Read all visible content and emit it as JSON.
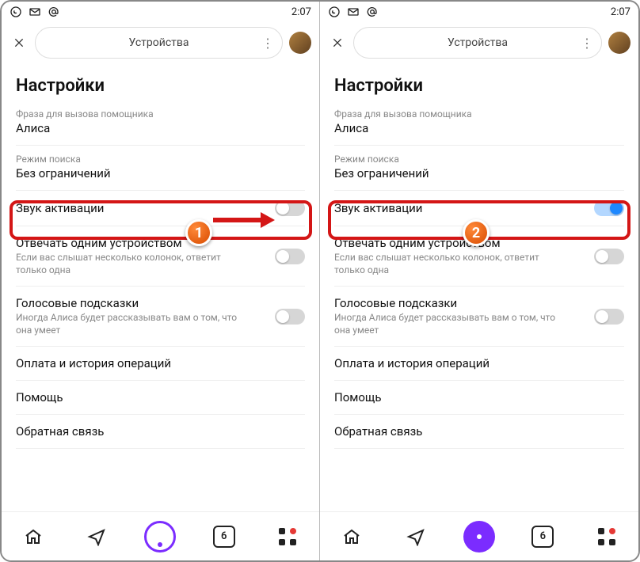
{
  "status": {
    "time": "2:07"
  },
  "topbar": {
    "title": "Устройства"
  },
  "page": {
    "title": "Настройки",
    "activation_phrase": {
      "label": "Фраза для вызова помощника",
      "value": "Алиса"
    },
    "search_mode": {
      "label": "Режим поиска",
      "value": "Без ограничений"
    },
    "activation_sound": {
      "label": "Звук активации"
    },
    "single_device": {
      "label": "Отвечать одним устройством",
      "hint": "Если вас слышат несколько колонок, ответит только одна"
    },
    "voice_hints": {
      "label": "Голосовые подсказки",
      "hint": "Иногда Алиса будет рассказывать вам о том, что она умеет"
    },
    "payments": {
      "label": "Оплата и история операций"
    },
    "help": {
      "label": "Помощь"
    },
    "feedback": {
      "label": "Обратная связь"
    }
  },
  "nav": {
    "count": "6"
  },
  "badges": {
    "one": "1",
    "two": "2"
  }
}
